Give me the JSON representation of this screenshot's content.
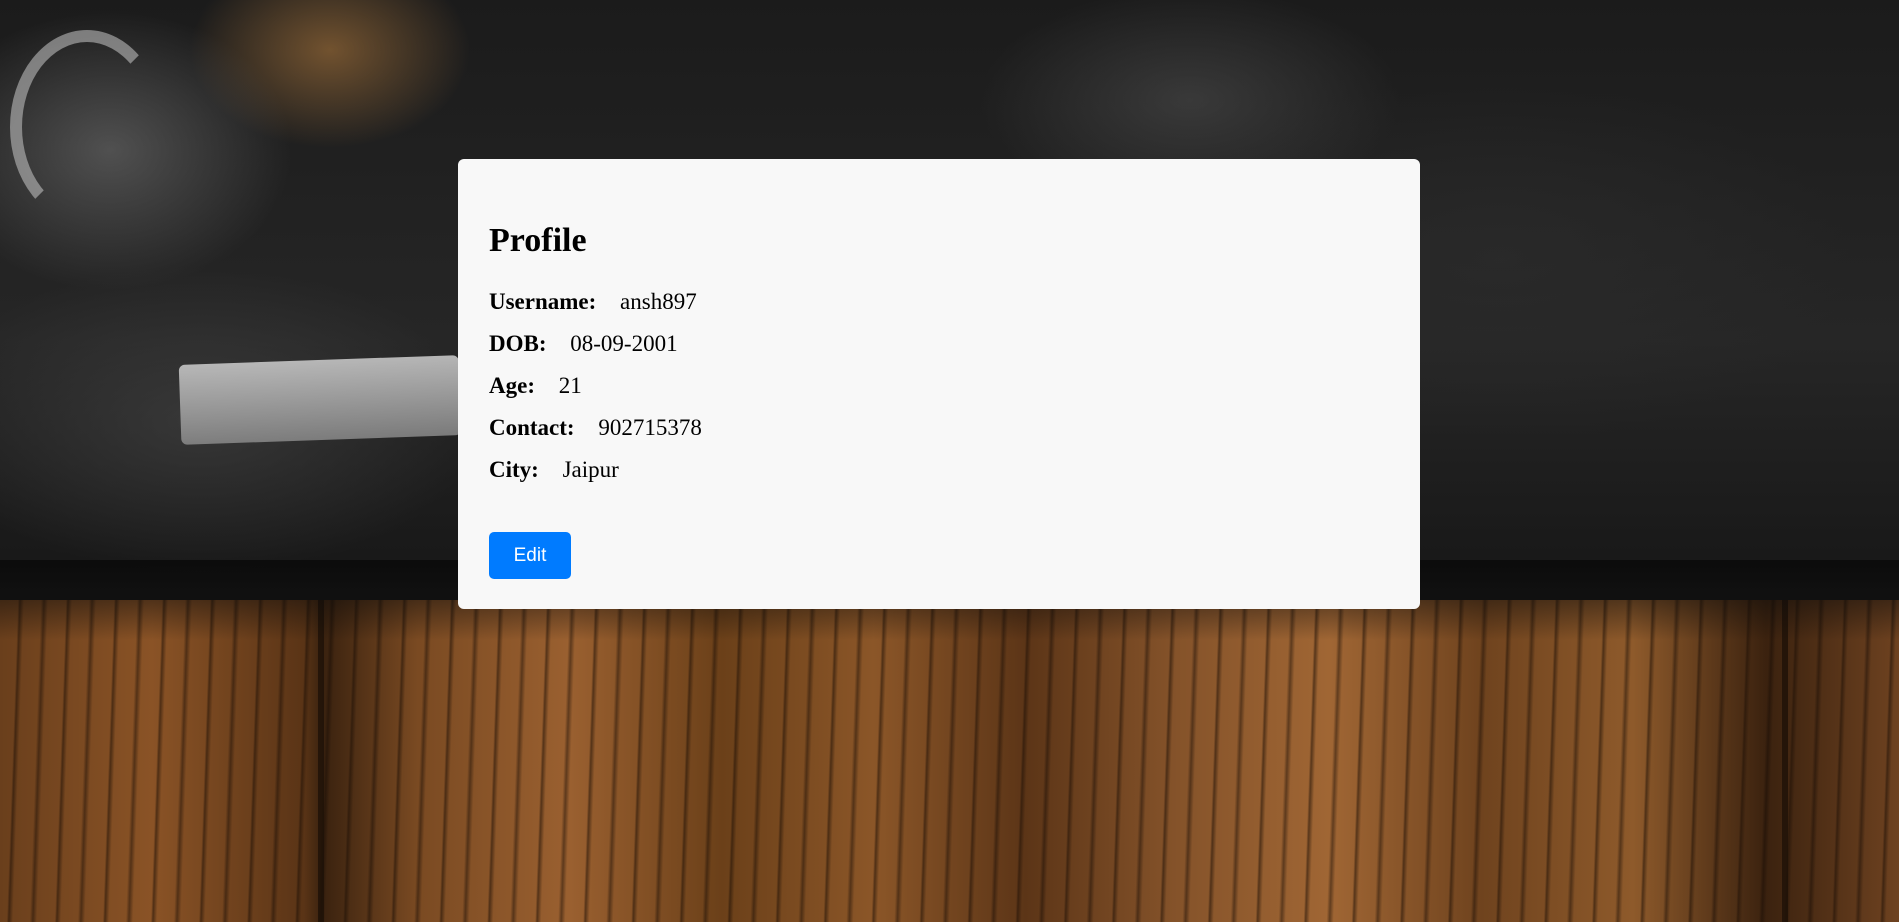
{
  "profile": {
    "title": "Profile",
    "fields": [
      {
        "label": "Username:",
        "value": "ansh897"
      },
      {
        "label": "DOB:",
        "value": "08-09-2001"
      },
      {
        "label": "Age:",
        "value": "21"
      },
      {
        "label": "Contact:",
        "value": "902715378"
      },
      {
        "label": "City:",
        "value": "Jaipur"
      }
    ],
    "edit_label": "Edit"
  },
  "colors": {
    "card_background": "#f8f8f8",
    "button_primary": "#007bff",
    "button_text": "#ffffff"
  }
}
